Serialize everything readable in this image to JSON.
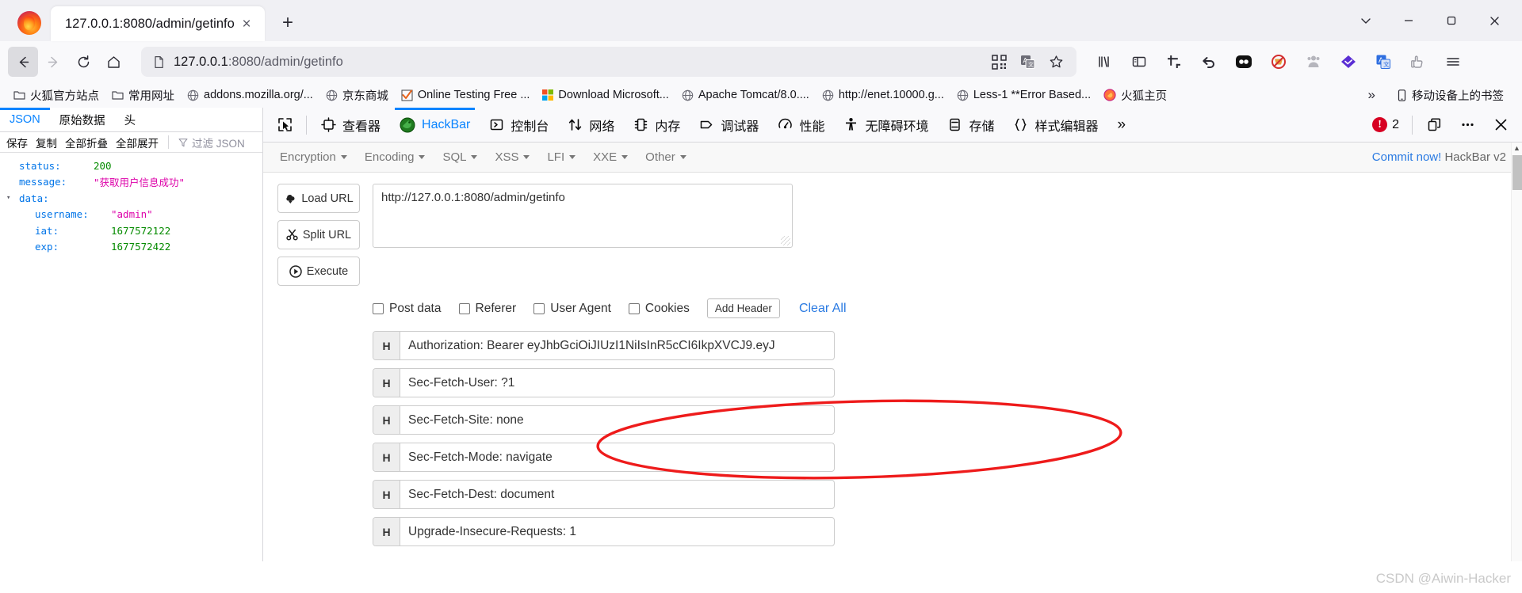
{
  "browser": {
    "tab": {
      "title": "127.0.0.1:8080/admin/getinfo",
      "close_label": "×"
    },
    "new_tab_label": "+",
    "window_controls": {
      "list_all_tabs": "⌄",
      "minimize": "─",
      "maximize": "❐",
      "close": "✕"
    },
    "address": {
      "scheme_host": "127.0.0.1",
      "rest": ":8080/admin/getinfo",
      "full": "127.0.0.1:8080/admin/getinfo"
    },
    "urlbar_icons": [
      "qr-code-icon",
      "translate-icon",
      "bookmark-star-icon"
    ],
    "toolbar_icons": [
      "library-icon",
      "sidebar-icon",
      "screenshot-icon",
      "undo-icon",
      "lastpass-icon",
      "adblock-icon",
      "privacy-badger-icon",
      "violentmonkey-icon",
      "translate-ext-icon",
      "sponsorblock-icon",
      "app-menu-icon"
    ],
    "bookmarks": [
      {
        "icon": "folder-icon",
        "label": "火狐官方站点"
      },
      {
        "icon": "folder-icon",
        "label": "常用网址"
      },
      {
        "icon": "globe-icon",
        "label": "addons.mozilla.org/..."
      },
      {
        "icon": "globe-icon",
        "label": "京东商城"
      },
      {
        "icon": "check-orange-icon",
        "label": "Online Testing Free ..."
      },
      {
        "icon": "microsoft-icon",
        "label": "Download Microsoft..."
      },
      {
        "icon": "globe-icon",
        "label": "Apache Tomcat/8.0...."
      },
      {
        "icon": "globe-icon",
        "label": "http://enet.10000.g..."
      },
      {
        "icon": "globe-icon",
        "label": "Less-1 **Error Based..."
      },
      {
        "icon": "firefox-icon",
        "label": "火狐主页"
      }
    ],
    "bookmarks_overflow": "»",
    "mobile_bookmarks": {
      "icon": "phone-icon",
      "label": "移动设备上的书签"
    }
  },
  "json_viewer": {
    "tabs": [
      {
        "label": "JSON",
        "active": true
      },
      {
        "label": "原始数据",
        "active": false
      },
      {
        "label": "头",
        "active": false
      }
    ],
    "tools": [
      "保存",
      "复制",
      "全部折叠",
      "全部展开"
    ],
    "filter_placeholder": "过滤 JSON",
    "filter_icon": "funnel-icon",
    "rows": [
      {
        "key": "status:",
        "value": "200",
        "type": "number",
        "level": 1
      },
      {
        "key": "message:",
        "value": "\"获取用户信息成功\"",
        "type": "string",
        "level": 1
      },
      {
        "key": "data:",
        "value": "",
        "type": "object",
        "level": 0,
        "expander": "▾"
      },
      {
        "key": "username:",
        "value": "\"admin\"",
        "type": "string",
        "level": 2
      },
      {
        "key": "iat:",
        "value": "1677572122",
        "type": "number",
        "level": 2
      },
      {
        "key": "exp:",
        "value": "1677572422",
        "type": "number",
        "level": 2
      }
    ]
  },
  "devtools": {
    "picker_icon": "element-picker-icon",
    "tabs": [
      {
        "icon": "inspector-icon",
        "label": "查看器",
        "active": false
      },
      {
        "icon": "hackbar-icon",
        "label": "HackBar",
        "active": true
      },
      {
        "icon": "console-icon",
        "label": "控制台",
        "active": false
      },
      {
        "icon": "network-icon",
        "label": "网络",
        "active": false
      },
      {
        "icon": "memory-icon",
        "label": "内存",
        "active": false
      },
      {
        "icon": "debugger-icon",
        "label": "调试器",
        "active": false
      },
      {
        "icon": "performance-icon",
        "label": "性能",
        "active": false
      },
      {
        "icon": "accessibility-icon",
        "label": "无障碍环境",
        "active": false
      },
      {
        "icon": "storage-icon",
        "label": "存储",
        "active": false
      },
      {
        "icon": "style-editor-icon",
        "label": "样式编辑器",
        "active": false
      }
    ],
    "overflow": "»",
    "error_count": "2",
    "error_icon": "error-badge-icon",
    "dock_icon": "dock-layout-icon",
    "meatball_icon": "more-options-icon",
    "close_icon": "close-devtools-icon"
  },
  "hackbar": {
    "menus": [
      "Encryption",
      "Encoding",
      "SQL",
      "XSS",
      "LFI",
      "XXE",
      "Other"
    ],
    "commit_link": "Commit now!",
    "version_label": "HackBar v2",
    "buttons": [
      {
        "icon": "load-url-icon",
        "label": "Load URL"
      },
      {
        "icon": "split-url-icon",
        "label": "Split URL"
      },
      {
        "icon": "execute-icon",
        "label": "Execute"
      }
    ],
    "url_value": "http://127.0.0.1:8080/admin/getinfo",
    "checkboxes": [
      {
        "label": "Post data",
        "checked": false
      },
      {
        "label": "Referer",
        "checked": false
      },
      {
        "label": "User Agent",
        "checked": false
      },
      {
        "label": "Cookies",
        "checked": false
      }
    ],
    "add_header_label": "Add Header",
    "clear_all_label": "Clear All",
    "header_badge": "H",
    "headers": [
      "Authorization: Bearer eyJhbGciOiJIUzI1NiIsInR5cCI6IkpXVCJ9.eyJ",
      "Sec-Fetch-User: ?1",
      "Sec-Fetch-Site: none",
      "Sec-Fetch-Mode: navigate",
      "Sec-Fetch-Dest: document",
      "Upgrade-Insecure-Requests: 1"
    ],
    "annotation": {
      "shape": "ellipse",
      "color": "#ee1b1b",
      "targets_header_index": 0
    }
  },
  "watermark": "CSDN @Aiwin-Hacker",
  "colors": {
    "accent_blue": "#0a84ff",
    "link_blue": "#2a7ae2",
    "json_key": "#0074e8",
    "json_number": "#058b00",
    "json_string": "#dd00a9",
    "annotation_red": "#ee1b1b",
    "error_red": "#d70022"
  }
}
